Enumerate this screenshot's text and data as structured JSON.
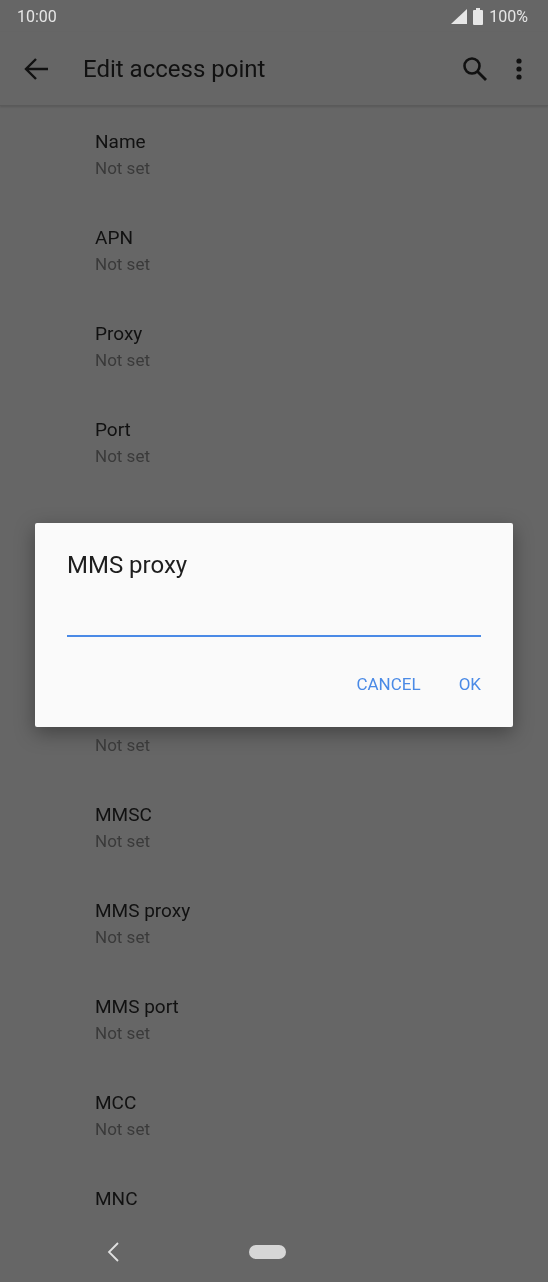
{
  "status_bar": {
    "time": "10:00",
    "battery": "100%"
  },
  "toolbar": {
    "title": "Edit access point"
  },
  "settings_before": [
    {
      "title": "Name",
      "summary": "Not set"
    },
    {
      "title": "APN",
      "summary": "Not set"
    },
    {
      "title": "Proxy",
      "summary": "Not set"
    },
    {
      "title": "Port",
      "summary": "Not set"
    }
  ],
  "dialog": {
    "title": "MMS proxy",
    "input": {
      "focused": true
    },
    "buttons": [
      "CANCEL",
      "OK"
    ]
  },
  "covered_row_summary": "Not set",
  "settings_after": [
    {
      "title": "MMSC",
      "summary": "Not set"
    },
    {
      "title": "MMS proxy",
      "summary": "Not set"
    },
    {
      "title": "MMS port",
      "summary": "Not set"
    },
    {
      "title": "MCC",
      "summary": "Not set"
    },
    {
      "title": "MNC"
    }
  ]
}
